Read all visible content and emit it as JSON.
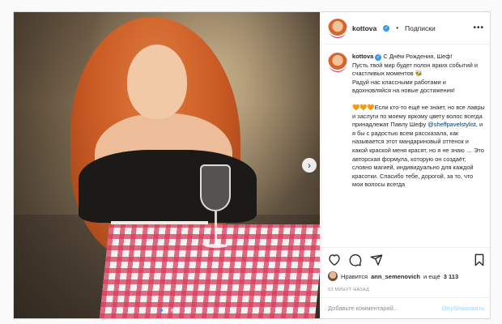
{
  "post": {
    "photo_alt": "",
    "carousel": {
      "total": 4,
      "active": 1
    }
  },
  "header": {
    "username": "kottova",
    "verified_mark": "✓",
    "separator": "•",
    "follow_label": "Подписки",
    "more_icon": "•••"
  },
  "caption": {
    "username": "kottova",
    "verified_mark": "✓",
    "p1": "С Днём Рождения, Шеф!\nПусть твой мир будет полон ярких событий и счастливых моментов 🐝\nРадуй нас классными работами и вдохновляйся на новые достижения!",
    "hearts": "🧡🧡🧡",
    "p2_a": "Если кто-то ещё не знает, но все лавры и заслуги по моему яркому цвету волос всегда принадлежат Павлу Шефу ",
    "mention": "@sheffpavelstylist",
    "p2_b": ", и я бы с радостью всем рассказала, как называется этот мандариновый оттенок и какой краской меня красят, но я не знаю … Это авторская формула, которую он создаёт, словно магией, индивидуально для каждой красотки. Спасибо тебе, дорогой, за то, что мои волосы всегда"
  },
  "actions": {
    "like_icon": "heart-icon",
    "comment_icon": "comment-icon",
    "share_icon": "share-icon",
    "save_icon": "bookmark-icon"
  },
  "likes": {
    "prefix": "Нравится",
    "user": "ann_semenovich",
    "middle": "и ещё",
    "count": "3 113"
  },
  "time_ago": "53 МИНУТ НАЗАД",
  "comment": {
    "placeholder": "Добавьте комментарий...",
    "publish_label": "Опубликовать"
  },
  "colors": {
    "accent": "#3897f0",
    "link": "#00376b",
    "publish_disabled": "#b2dffc",
    "muted": "#8e8e8e"
  }
}
